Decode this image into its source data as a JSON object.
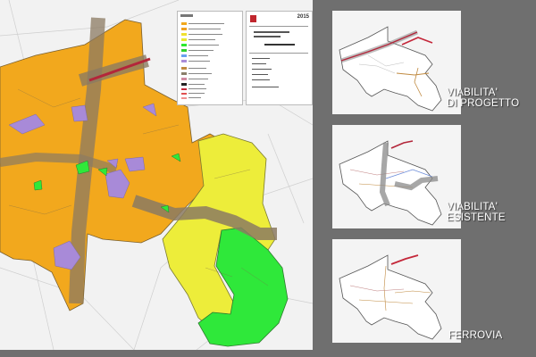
{
  "main_map": {
    "title_block": {
      "year": "2015"
    }
  },
  "panels": [
    {
      "label_line1": "VIABILITA'",
      "label_line2": "DI PROGETTO"
    },
    {
      "label_line1": "VIABILITA'",
      "label_line2": "ESISTENTE"
    },
    {
      "label_line1": "FERROVIA",
      "label_line2": ""
    }
  ],
  "colors": {
    "background": "#6f6f6f",
    "orange_zone": "#f2a81d",
    "yellow_zone": "#f0f040",
    "green_zone": "#2ee82e",
    "purple_zone": "#a98cd8",
    "road_buffer": "#8a7f6a",
    "road_design": "#b3263a",
    "road_existing": "#8a8a8a",
    "railway": "#c4273a"
  }
}
